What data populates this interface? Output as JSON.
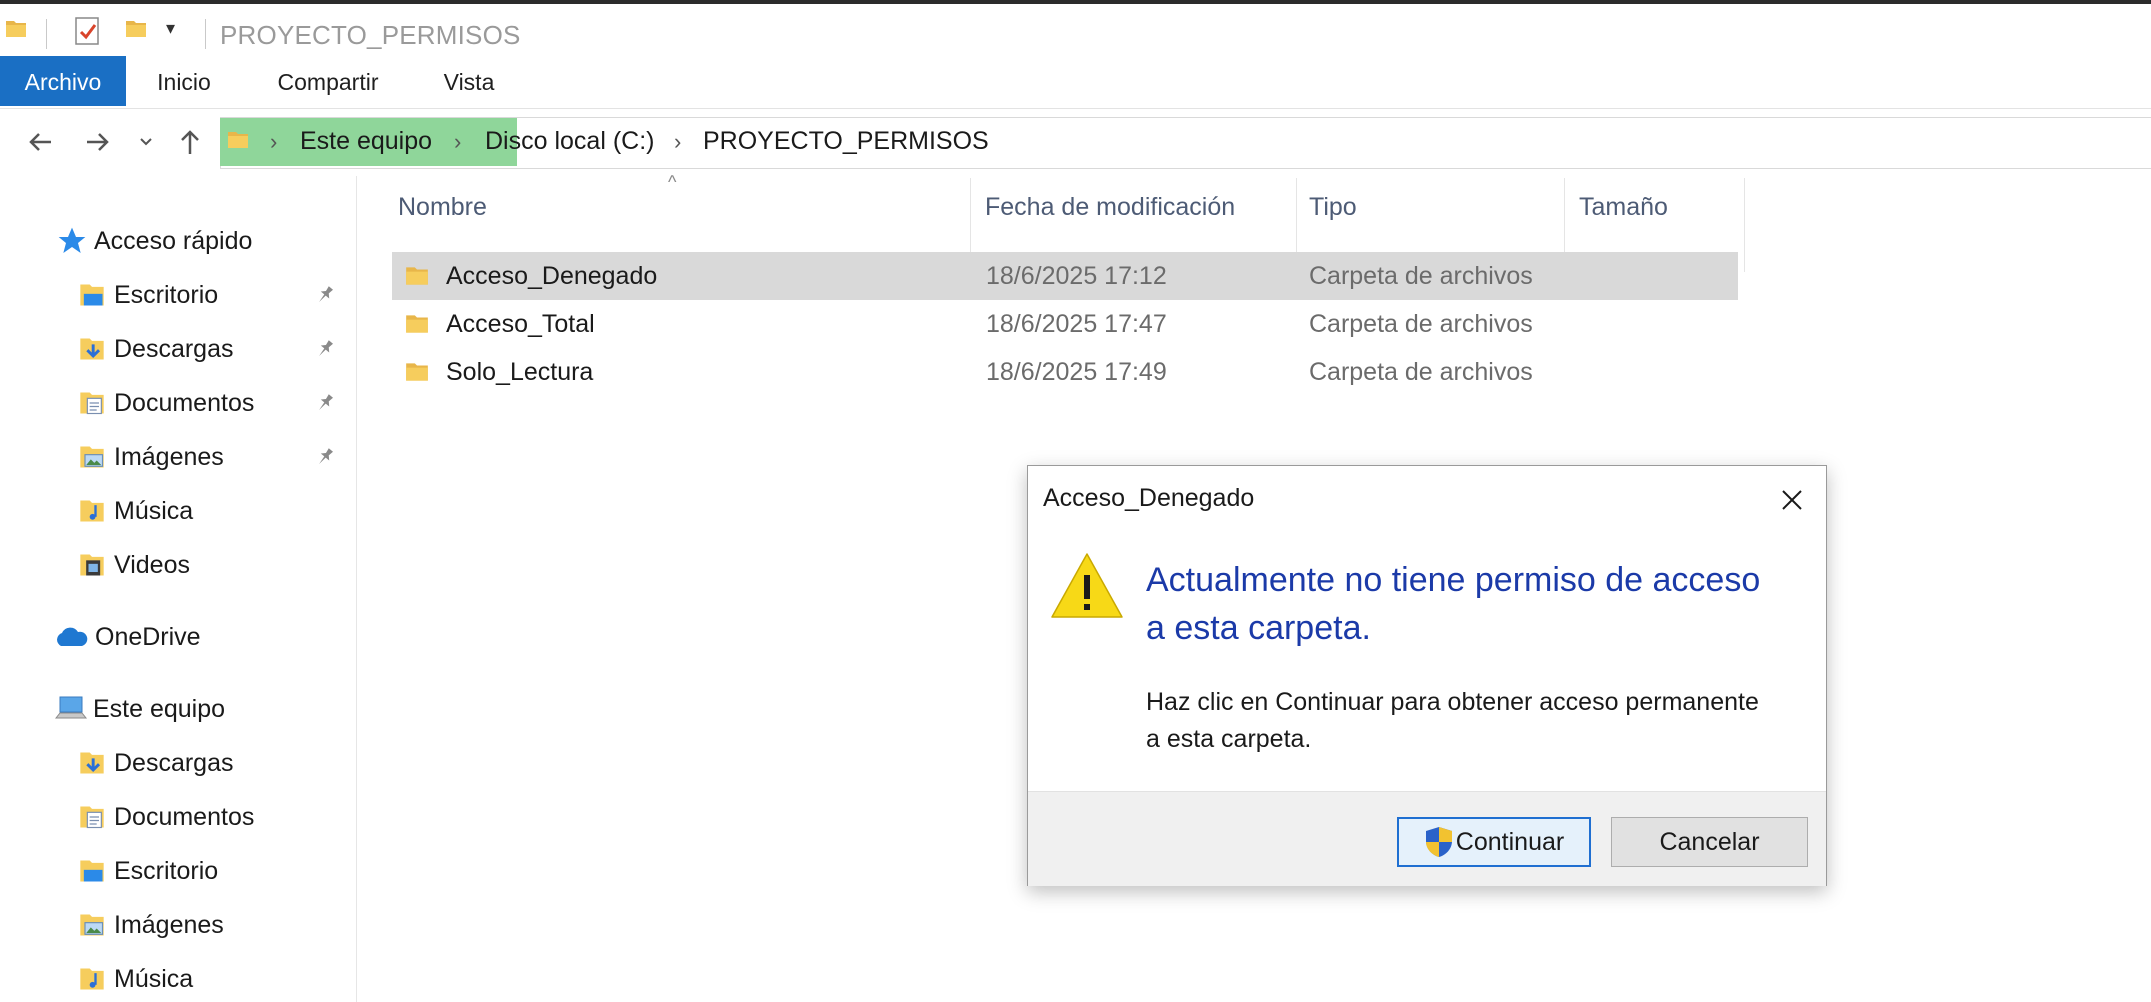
{
  "window": {
    "title": "PROYECTO_PERMISOS"
  },
  "ribbon": {
    "tabs": [
      "Archivo",
      "Inicio",
      "Compartir",
      "Vista"
    ],
    "active": "Archivo"
  },
  "address": {
    "crumbs": [
      "Este equipo",
      "Disco local (C:)",
      "PROYECTO_PERMISOS"
    ]
  },
  "sidebar": {
    "quick_access": {
      "label": "Acceso rápido",
      "items": [
        {
          "label": "Escritorio",
          "icon": "desktop-folder-icon",
          "pinned": true
        },
        {
          "label": "Descargas",
          "icon": "downloads-folder-icon",
          "pinned": true
        },
        {
          "label": "Documentos",
          "icon": "documents-folder-icon",
          "pinned": true
        },
        {
          "label": "Imágenes",
          "icon": "pictures-folder-icon",
          "pinned": true
        },
        {
          "label": "Música",
          "icon": "music-folder-icon",
          "pinned": false
        },
        {
          "label": "Videos",
          "icon": "videos-folder-icon",
          "pinned": false
        }
      ]
    },
    "onedrive": {
      "label": "OneDrive"
    },
    "this_pc": {
      "label": "Este equipo",
      "items": [
        {
          "label": "Descargas",
          "icon": "downloads-folder-icon"
        },
        {
          "label": "Documentos",
          "icon": "documents-folder-icon"
        },
        {
          "label": "Escritorio",
          "icon": "desktop-folder-icon"
        },
        {
          "label": "Imágenes",
          "icon": "pictures-folder-icon"
        },
        {
          "label": "Música",
          "icon": "music-folder-icon"
        }
      ]
    }
  },
  "columns": {
    "name": "Nombre",
    "date": "Fecha de modificación",
    "type": "Tipo",
    "size": "Tamaño"
  },
  "files": [
    {
      "name": "Acceso_Denegado",
      "date": "18/6/2025 17:12",
      "type": "Carpeta de archivos",
      "selected": true
    },
    {
      "name": "Acceso_Total",
      "date": "18/6/2025 17:47",
      "type": "Carpeta de archivos",
      "selected": false
    },
    {
      "name": "Solo_Lectura",
      "date": "18/6/2025 17:49",
      "type": "Carpeta de archivos",
      "selected": false
    }
  ],
  "dialog": {
    "title": "Acceso_Denegado",
    "main_line1": "Actualmente no tiene permiso de acceso",
    "main_line2": "a esta carpeta.",
    "sub_line1": "Haz clic en Continuar para obtener acceso permanente",
    "sub_line2": "a esta carpeta.",
    "continue_label": "Continuar",
    "cancel_label": "Cancelar"
  },
  "colors": {
    "accent": "#1a6fc4",
    "dialog_heading": "#1b3aa8",
    "address_highlight": "#8fd69a",
    "selection": "#d9d9d9"
  }
}
